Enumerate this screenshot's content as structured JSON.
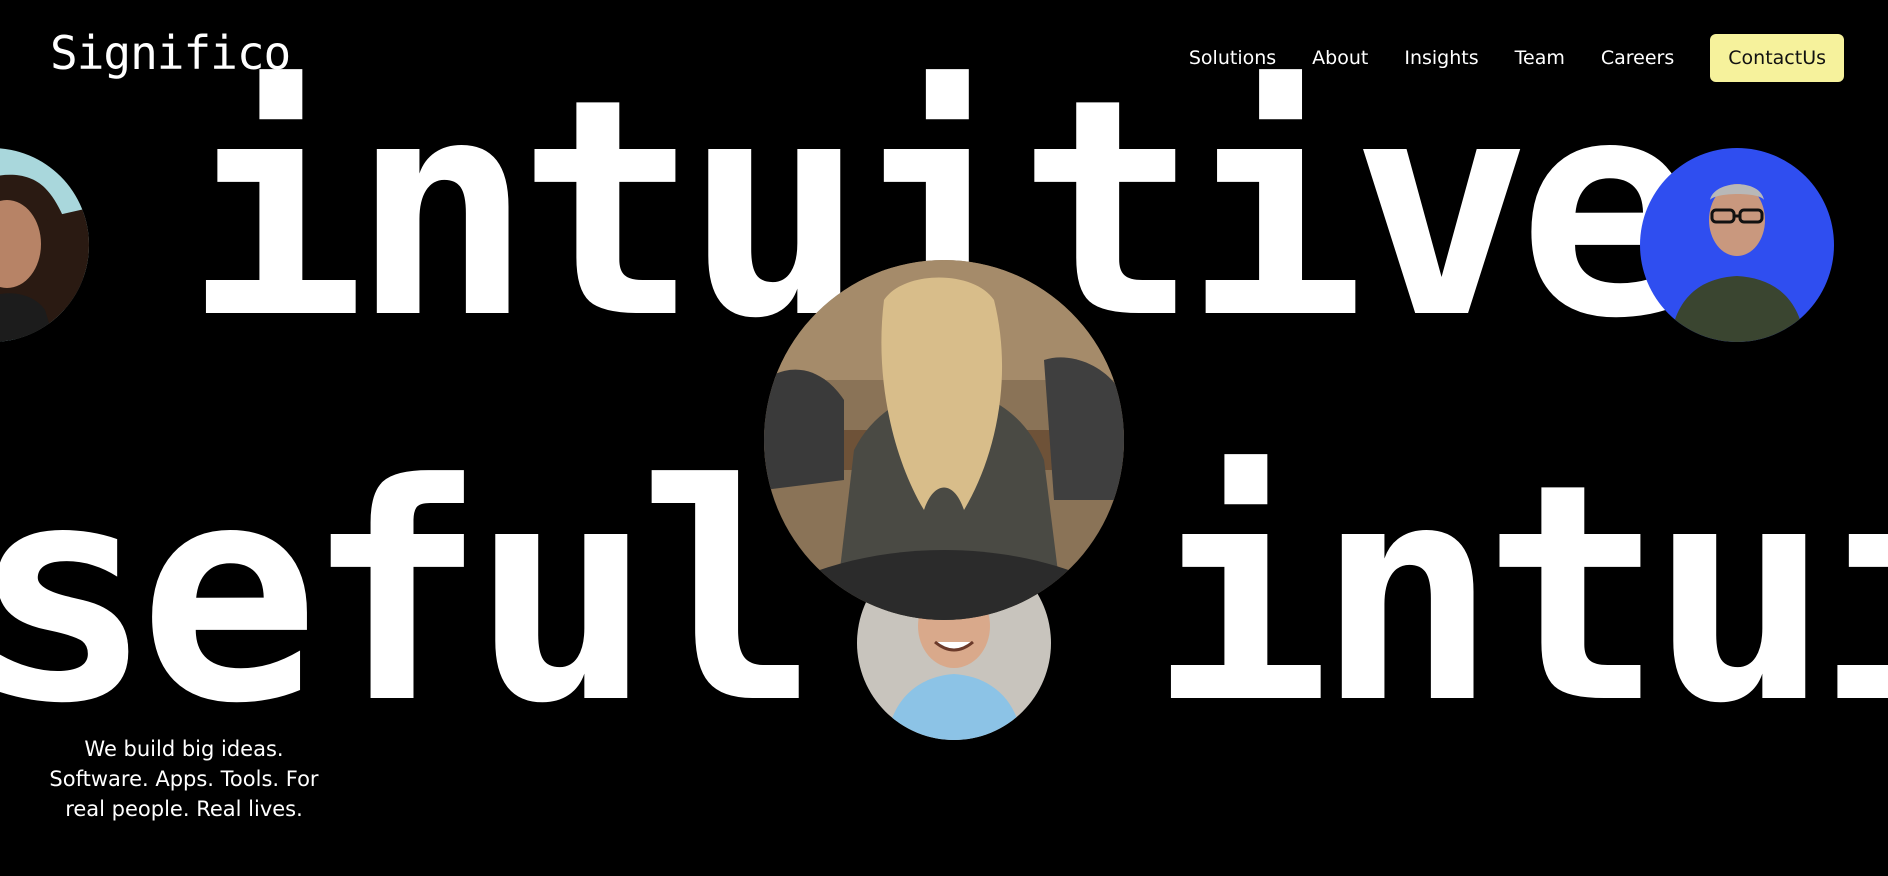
{
  "brand": {
    "logo_text": "Significo"
  },
  "nav": {
    "items": [
      {
        "label": "Solutions"
      },
      {
        "label": "About"
      },
      {
        "label": "Insights"
      },
      {
        "label": "Team"
      },
      {
        "label": "Careers"
      }
    ],
    "contact_label": "ContactUs",
    "contact_color": "#f6f29c"
  },
  "hero": {
    "word_top": "intuitive",
    "word_bottom_left": "seful",
    "word_bottom_right": "intui"
  },
  "tagline": {
    "lines": [
      "We build big ideas.",
      "Software. Apps. Tools. For",
      "real people. Real lives."
    ]
  },
  "colors": {
    "background": "#000000",
    "text": "#ffffff",
    "accent": "#f6f29c",
    "portrait_blue": "#2f4ef0"
  }
}
